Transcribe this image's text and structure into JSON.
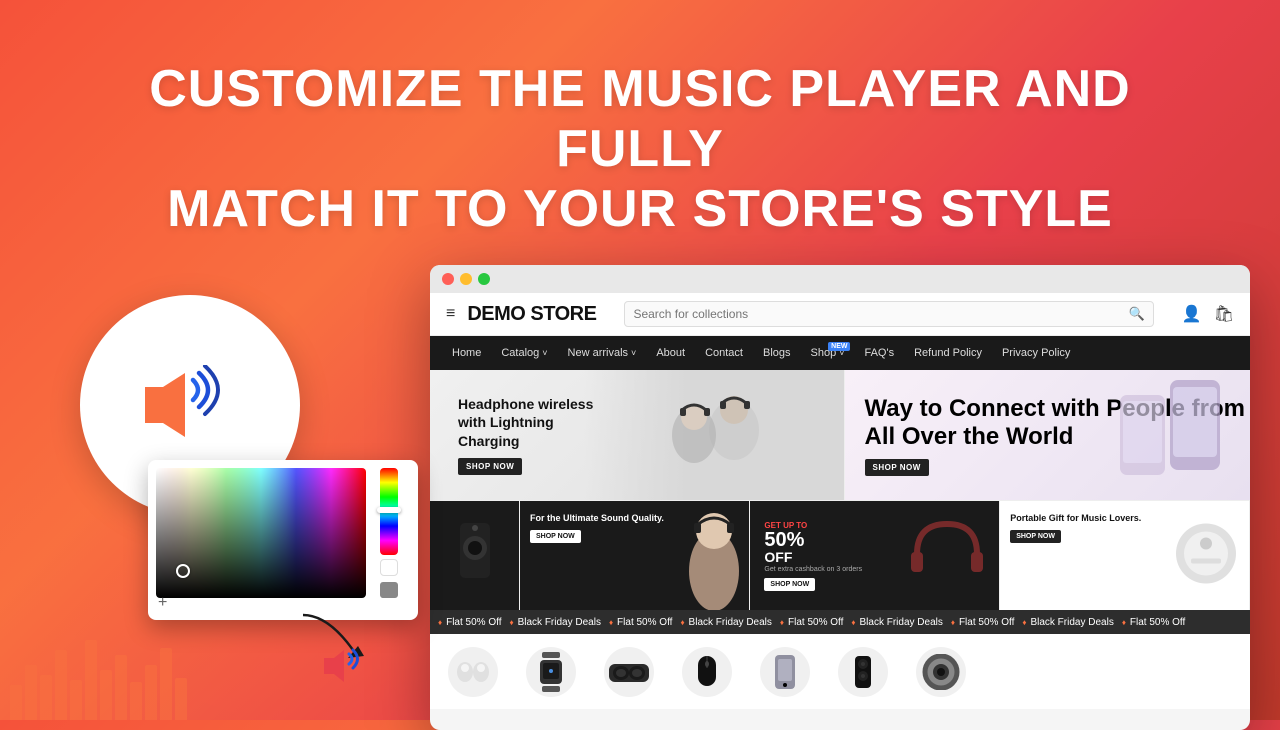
{
  "page": {
    "background": "gradient red-orange",
    "hero_title_line1": "CUSTOMIZE THE MUSIC PLAYER AND FULLY",
    "hero_title_line2": "MATCH IT TO YOUR STORE'S STYLE"
  },
  "browser": {
    "store_name": "DEMO STORE",
    "search_placeholder": "Search for collections",
    "nav_items": [
      {
        "label": "Home",
        "has_dropdown": false
      },
      {
        "label": "Catalog",
        "has_dropdown": true
      },
      {
        "label": "New arrivals",
        "has_dropdown": true
      },
      {
        "label": "About",
        "has_dropdown": false
      },
      {
        "label": "Contact",
        "has_dropdown": false
      },
      {
        "label": "Blogs",
        "has_dropdown": false
      },
      {
        "label": "Shop",
        "has_dropdown": true,
        "badge": "NEW"
      },
      {
        "label": "FAQ's",
        "has_dropdown": false
      },
      {
        "label": "Refund Policy",
        "has_dropdown": false
      },
      {
        "label": "Privacy Policy",
        "has_dropdown": false
      }
    ],
    "hero_banner_left": {
      "title": "Headphone wireless with Lightning Charging",
      "button": "SHOP NOW"
    },
    "hero_banner_right": {
      "title": "Way to Connect with People from All Over the World",
      "button": "SHOP NOW"
    },
    "product_cards": [
      {
        "type": "dark",
        "title": "For the Ultimate Sound Quality.",
        "button": "SHOP NOW"
      },
      {
        "type": "sale",
        "sale_text": "GET UP TO",
        "percent": "50% OFF",
        "sub": "Get extra cashback on 3 orders",
        "button": "SHOP NOW"
      },
      {
        "type": "light",
        "title": "Portable Gift for Music Lovers.",
        "button": "SHOP NOW"
      }
    ],
    "ticker_items": [
      "♦ Flat 50% Off",
      "♦ Black Friday Deals",
      "♦ Flat 50% Off",
      "♦ Black Friday Deals",
      "♦ Flat 50% Off",
      "♦ Black Friday Deals",
      "♦ Flat 50% Off",
      "♦ Black Friday Deals",
      "♦ Flat 50% Off"
    ]
  },
  "icons": {
    "hamburger": "≡",
    "search": "🔍",
    "user": "👤",
    "cart": "🛒",
    "chevron_down": "˅",
    "speaker": "🔊"
  }
}
